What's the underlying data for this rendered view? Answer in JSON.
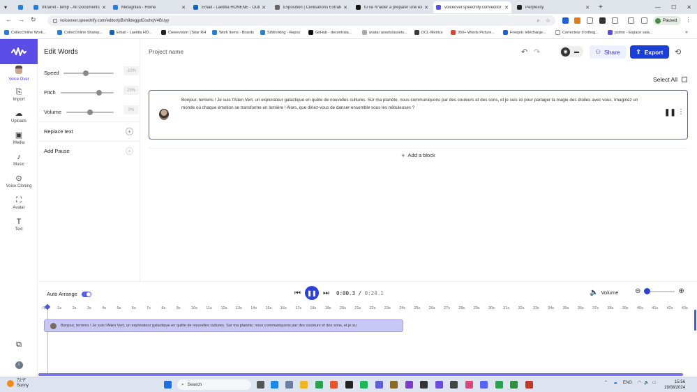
{
  "browser": {
    "tabs": [
      {
        "title": "Intranet - temp - All Documents",
        "color": "#2b7cd3"
      },
      {
        "title": "Metagrilan - Home",
        "color": "#2b7cd3"
      },
      {
        "title": "Email - Laetitia HONENE - Outlook",
        "color": "#0a64c8"
      },
      {
        "title": "Exposition | Civilisations Extraterrestres",
        "color": "#666"
      },
      {
        "title": "tu va m'aider a preparer une exposition",
        "color": "#111"
      },
      {
        "title": "voiceover.speechify.com/editor",
        "color": "#5b4ee8"
      },
      {
        "title": "Perplexity",
        "color": "#222"
      }
    ],
    "url": "voiceover.speechify.com/editor/pBsh9deggdCoohqV4BUyy",
    "profile_status": "Paused",
    "bookmarks": [
      "CollecOnline Work...",
      "CollecOnline Sharep...",
      "Email - Laetitia HO...",
      "Creeevision | Sitar RH",
      "Work Items - Boards",
      "SitWorking - Repos",
      "GitHub - decentrala...",
      "avatar assets/assets...",
      "DCL-Metrics",
      "350+ Words Picture...",
      "Freepik: télécharge...",
      "Correcteur d'orthog...",
      "pstmn - Espace sala..."
    ]
  },
  "rail": {
    "items": [
      {
        "label": "Voice Over",
        "icon": "avatar"
      },
      {
        "label": "Import",
        "icon": "import-icon"
      },
      {
        "label": "Uploads",
        "icon": "upload-icon"
      },
      {
        "label": "Media",
        "icon": "media-icon"
      },
      {
        "label": "Music",
        "icon": "music-icon"
      },
      {
        "label": "Voice Cloning",
        "icon": "voice-cloning-icon"
      },
      {
        "label": "Avatar",
        "icon": "avatar-icon"
      },
      {
        "label": "Text",
        "icon": "text-icon"
      }
    ]
  },
  "panel": {
    "title": "Edit Words",
    "speed": {
      "label": "Speed",
      "value": "-10%",
      "level": 0.45
    },
    "pitch": {
      "label": "Pitch",
      "value": "23%",
      "level": 0.73
    },
    "volume": {
      "label": "Volume",
      "value": "0%",
      "level": 0.5
    },
    "replace": "Replace text",
    "pause": "Add Pause"
  },
  "main": {
    "project_name": "Project name",
    "share": "Share",
    "export": "Export",
    "select_all": "Select All",
    "block_text": "Bonjour, terriens ! Je suis l'Alien Vert, un explorateur galactique en quête de nouvelles cultures. Sur ma planète, nous communiquons par des couleurs et des sons, et je suis ici pour partager la magie des étoiles avec vous. Imaginez un monde où chaque émotion se transforme en lumière ! Alors, que diriez-vous de danser ensemble sous les nébuleuses ?",
    "add_block": "Add a block"
  },
  "player": {
    "auto_arrange": "Auto Arrange",
    "time_current": "0:00.3",
    "time_sep": " / ",
    "time_total": "0:24.1",
    "volume": "Volume",
    "ticks": [
      "0s",
      "1s",
      "2s",
      "3s",
      "4s",
      "5s",
      "6s",
      "7s",
      "8s",
      "9s",
      "10s",
      "11s",
      "12s",
      "13s",
      "14s",
      "15s",
      "16s",
      "17s",
      "18s",
      "19s",
      "20s",
      "21s",
      "22s",
      "23s",
      "24s",
      "25s",
      "26s",
      "27s",
      "28s",
      "29s",
      "30s",
      "31s",
      "32s",
      "33s",
      "34s",
      "35s",
      "36s",
      "37s",
      "38s",
      "39s",
      "40s",
      "41s",
      "42s",
      "43s"
    ],
    "clip_text": "Bonjour, terriens ! Je suis l'Alien Vert, un explorateur galactique en quête de nouvelles cultures. Sur ma planète, nous communiquons par des couleurs et des sons, et je su"
  },
  "taskbar": {
    "temp": "72°F",
    "weather": "Sunny",
    "search": "Search",
    "lang": "ENG",
    "time": "15:56",
    "date": "19/08/2024"
  }
}
